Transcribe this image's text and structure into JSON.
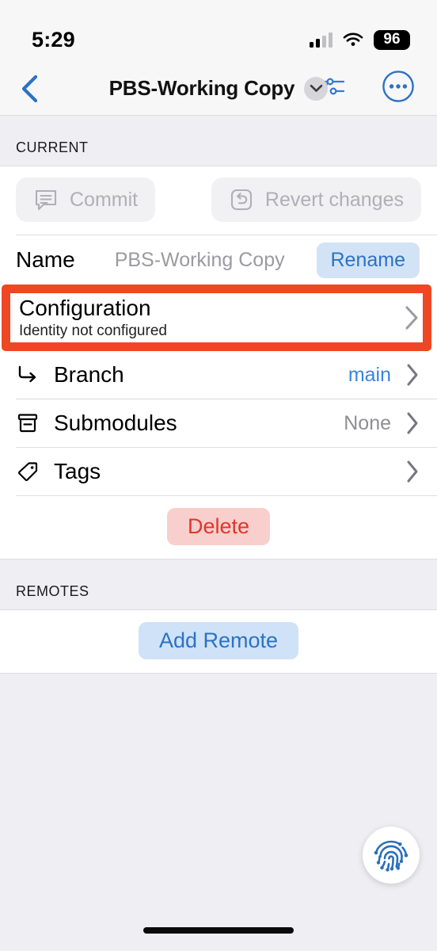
{
  "status_bar": {
    "time": "5:29",
    "signal_icon": "cellular-signal-icon",
    "wifi_icon": "wifi-icon",
    "battery_level": "96"
  },
  "nav_bar": {
    "back_icon": "chevron-left-icon",
    "title": "PBS-Working Copy",
    "title_chevron_icon": "chevron-down-icon",
    "graph_icon": "branch-graph-icon",
    "more_icon": "more-circle-icon"
  },
  "current_section": {
    "header": "CURRENT",
    "actions": [
      {
        "label": "Commit",
        "icon": "commit-message-icon",
        "enabled": false
      },
      {
        "label": "Revert changes",
        "icon": "revert-undo-icon",
        "enabled": false
      }
    ],
    "name_row": {
      "label": "Name",
      "value": "PBS-Working Copy",
      "button": "Rename"
    },
    "configuration_row": {
      "title": "Configuration",
      "subtitle": "Identity not configured",
      "chevron_icon": "chevron-right-icon",
      "highlighted": true,
      "highlight_color": "#EF4723"
    },
    "rows": [
      {
        "label": "Branch",
        "value": "main",
        "value_style": "blue",
        "icon": "branch-arrow-icon"
      },
      {
        "label": "Submodules",
        "value": "None",
        "value_style": "grey",
        "icon": "archive-box-icon"
      },
      {
        "label": "Tags",
        "value": "",
        "value_style": "none",
        "icon": "tag-icon"
      }
    ],
    "delete_button": "Delete"
  },
  "remotes_section": {
    "header": "REMOTES",
    "add_button": "Add Remote"
  },
  "floating_button": {
    "icon": "fingerprint-icon"
  },
  "colors": {
    "accent_blue": "#2C72C4",
    "link_blue": "#3A83DE",
    "danger_red": "#E0362C",
    "highlight_orange": "#EF4723",
    "page_background": "#EFEEF3",
    "bar_background": "#F7F7F8"
  }
}
